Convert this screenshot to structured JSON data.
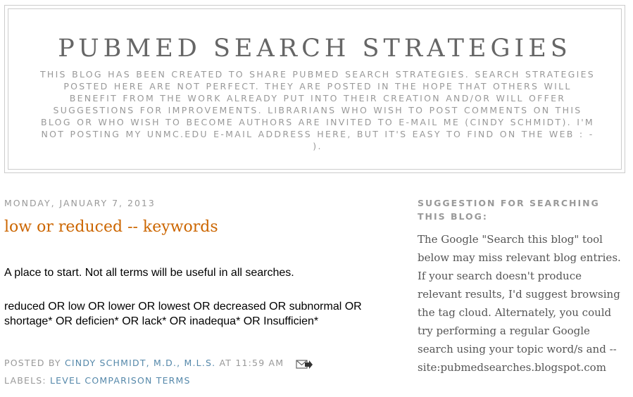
{
  "header": {
    "title": "PUBMED SEARCH STRATEGIES",
    "description": "This blog has been created to share PubMed search strategies. Search strategies posted here are not perfect. They are posted in the hope that others will benefit from the work already put into their creation and/or will offer suggestions for improvements. Librarians who wish to post comments on this blog or who wish to become authors are invited to e-mail me (Cindy Schmidt). I'm not posting my unmc.edu e-mail address here, but it's easy to find on the web : - )."
  },
  "post": {
    "date": "Monday, January 7, 2013",
    "title": "low or reduced -- keywords",
    "body_intro": "A place to start.  Not all terms will be useful in all searches.",
    "body_terms": "reduced OR low OR lower OR lowest OR decreased OR subnormal OR shortage* OR deficien* OR lack* OR inadequa* OR Insufficien*",
    "posted_by_label": "Posted by",
    "author": "Cindy Schmidt, M.D., M.L.S.",
    "at_label": "at",
    "time": "11:59 AM",
    "email_icon": "email-post-icon",
    "labels_label": "Labels:",
    "label_link": "level comparison terms"
  },
  "sidebar": {
    "title": "Suggestion for searching this blog:",
    "text": "The Google \"Search this blog\" tool below may miss relevant blog entries. If your search doesn't produce relevant results, I'd suggest browsing the tag cloud. Alternately, you could try performing a regular Google search using your topic word/s and --site:pubmedsearches.blogspot.com"
  },
  "colors": {
    "post_title": "#cc6600",
    "link": "#5588aa",
    "muted": "#999999",
    "border": "#cccccc"
  }
}
